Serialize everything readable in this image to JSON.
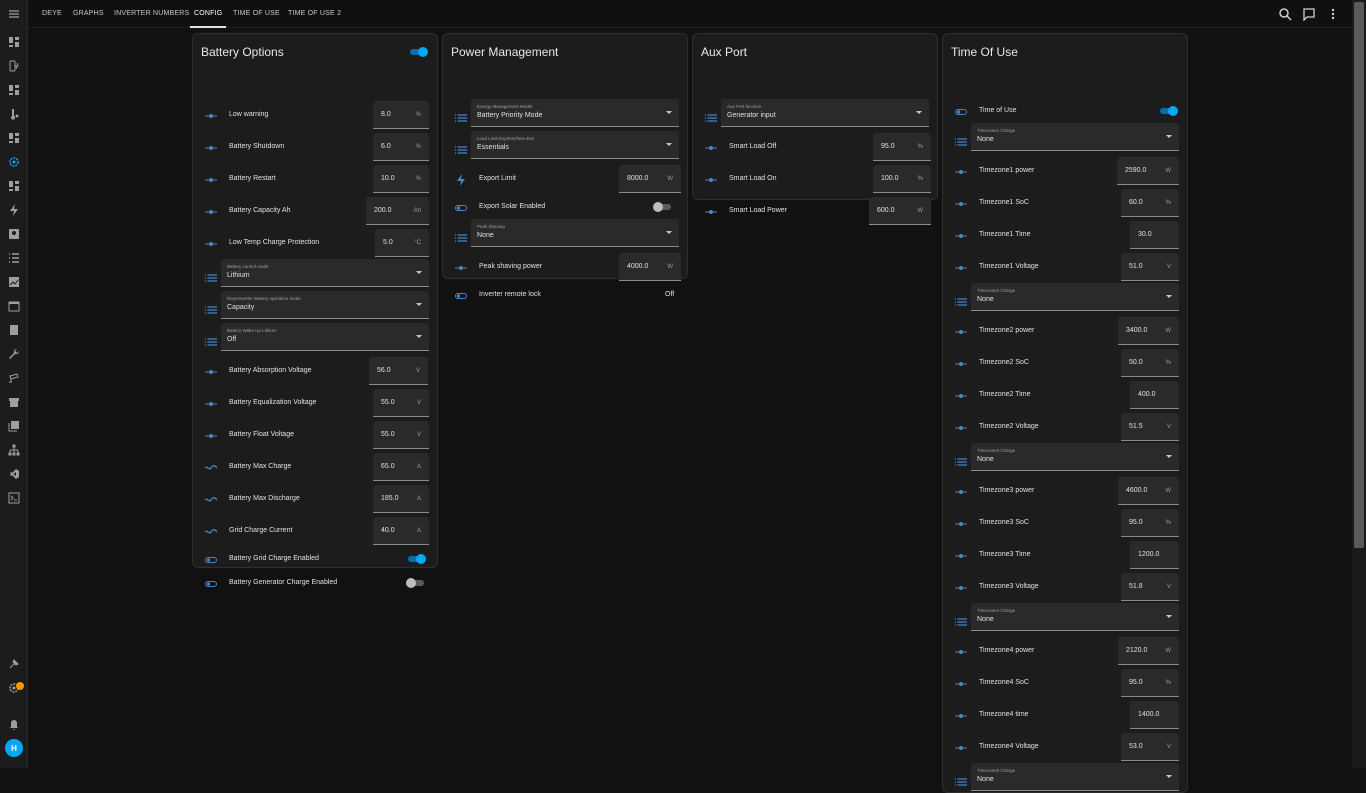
{
  "topbar": {
    "tabs": [
      "DEYE",
      "GRAPHS",
      "INVERTER NUMBERS",
      "CONFIG",
      "TIME OF USE",
      "TIME OF USE 2"
    ],
    "active_tab": "CONFIG"
  },
  "user": {
    "initial": "H"
  },
  "colors": {
    "accent": "#03a9f4",
    "card": "#1c1c1c",
    "background": "#111111",
    "badge": "#ff9800"
  },
  "cards": {
    "battery": {
      "title": "Battery Options",
      "toggle_on": true,
      "rows": [
        {
          "label": "Low warning",
          "value": "8.0",
          "unit": "%"
        },
        {
          "label": "Battery Shutdown",
          "value": "6.0",
          "unit": "%"
        },
        {
          "label": "Battery Restart",
          "value": "10.0",
          "unit": "%"
        },
        {
          "label": "Battery Capacity Ah",
          "value": "200.0",
          "unit": "Ah"
        },
        {
          "label": "Low Temp Charge Protection",
          "value": "5.0",
          "unit": "°C"
        },
        {
          "caption": "Battery control mode",
          "value": "Lithium"
        },
        {
          "caption": "DeyeInverter Battery operation mode",
          "value": "Capacity"
        },
        {
          "caption": "Battery Wake Up Lithium",
          "value": "Off"
        },
        {
          "label": "Battery Absorption Voltage",
          "value": "56.0",
          "unit": "V"
        },
        {
          "label": "Battery Equalization Voltage",
          "value": "55.0",
          "unit": "V"
        },
        {
          "label": "Battery Float Voltage",
          "value": "55.0",
          "unit": "V"
        },
        {
          "label": "Battery Max Charge",
          "value": "65.0",
          "unit": "A"
        },
        {
          "label": "Battery Max Discharge",
          "value": "185.0",
          "unit": "A"
        },
        {
          "label": "Grid Charge Current",
          "value": "40.0",
          "unit": "A"
        },
        {
          "label": "Battery Grid Charge Enabled",
          "on": true
        },
        {
          "label": "Battery Generator Charge Enabled",
          "on": false
        }
      ]
    },
    "power": {
      "title": "Power Management",
      "rows": [
        {
          "caption": "Energy Management Model",
          "value": "Battery Priority Mode"
        },
        {
          "caption": "Load Limit Exp/Ess/Non-Ess",
          "value": "Essentials"
        },
        {
          "label": "Export Limit",
          "value": "8000.0",
          "unit": "W"
        },
        {
          "label": "Export Solar Enabled",
          "on": false
        },
        {
          "caption": "Peak Shaving",
          "value": "None"
        },
        {
          "label": "Peak shaving power",
          "value": "4000.0",
          "unit": "W"
        },
        {
          "label": "Inverter remote lock",
          "state": "Off"
        }
      ]
    },
    "aux": {
      "title": "Aux Port",
      "rows": [
        {
          "caption": "Aux Port function",
          "value": "Generator input"
        },
        {
          "label": "Smart Load Off",
          "value": "95.0",
          "unit": "%"
        },
        {
          "label": "Smart Load On",
          "value": "100.0",
          "unit": "%"
        },
        {
          "label": "Smart Load Power",
          "value": "600.0",
          "unit": "W"
        }
      ]
    },
    "tou": {
      "title": "Time Of Use",
      "rows": [
        {
          "label": "Time of Use",
          "on": true
        },
        {
          "caption": "Timezone1 Charge",
          "value": "None"
        },
        {
          "label": "Timezone1 power",
          "value": "2590.0",
          "unit": "W"
        },
        {
          "label": "Timezone1 SoC",
          "value": "60.0",
          "unit": "%"
        },
        {
          "label": "Timezone1 Time",
          "value": "30.0",
          "unit": ""
        },
        {
          "label": "Timezone1 Voltage",
          "value": "51.0",
          "unit": "V"
        },
        {
          "caption": "Timezone2 Charge",
          "value": "None"
        },
        {
          "label": "Timezone2 power",
          "value": "3400.0",
          "unit": "W"
        },
        {
          "label": "Timezone2 SoC",
          "value": "50.0",
          "unit": "%"
        },
        {
          "label": "Timezone2 Time",
          "value": "400.0",
          "unit": ""
        },
        {
          "label": "Timezone2 Voltage",
          "value": "51.5",
          "unit": "V"
        },
        {
          "caption": "Timezone3 Charge",
          "value": "None"
        },
        {
          "label": "Timezone3 power",
          "value": "4600.0",
          "unit": "W"
        },
        {
          "label": "Timezone3 SoC",
          "value": "95.0",
          "unit": "%"
        },
        {
          "label": "Timezone3 Time",
          "value": "1200.0",
          "unit": ""
        },
        {
          "label": "Timezone3 Voltage",
          "value": "51.8",
          "unit": "V"
        },
        {
          "caption": "Timezone4 Charge",
          "value": "None"
        },
        {
          "label": "Timezone4 power",
          "value": "2120.0",
          "unit": "W"
        },
        {
          "label": "Timezone4 SoC",
          "value": "95.0",
          "unit": "%"
        },
        {
          "label": "Timezone4 time",
          "value": "1400.0",
          "unit": ""
        },
        {
          "label": "Timezone4 Voltage",
          "value": "53.0",
          "unit": "V"
        },
        {
          "caption": "Timezone5 Charge",
          "value": "None"
        }
      ]
    }
  }
}
